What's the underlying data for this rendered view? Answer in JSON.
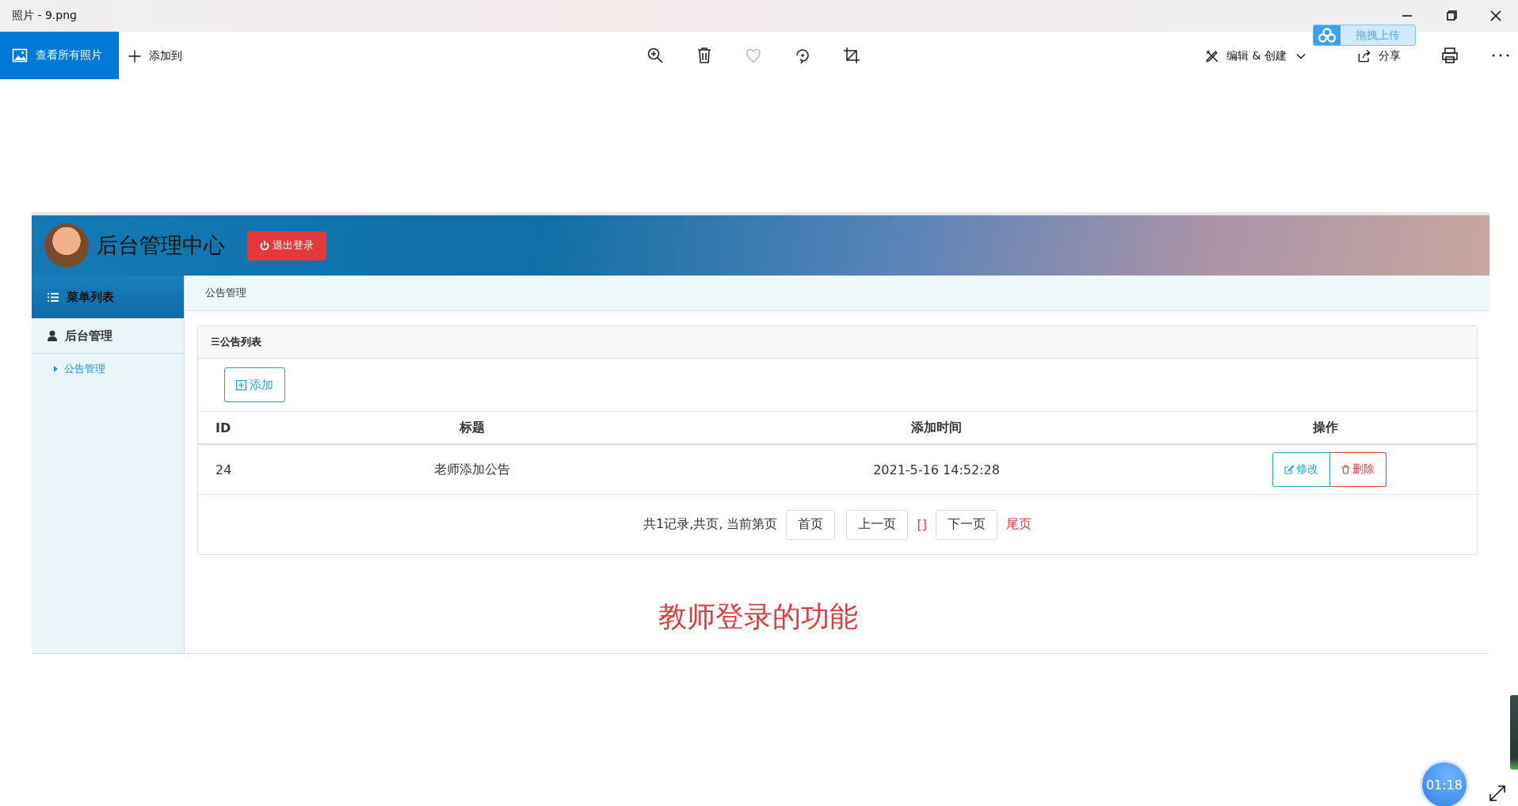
{
  "window": {
    "title": "照片 - 9.png"
  },
  "toolbar": {
    "view_all": "查看所有照片",
    "add_to": "添加到",
    "edit_create": "编辑 & 创建",
    "share": "分享"
  },
  "upload_widget": {
    "label": "拖拽上传"
  },
  "admin": {
    "title": "后台管理中心",
    "logout": "退出登录",
    "sidebar": {
      "header": "菜单列表",
      "groups": [
        {
          "label": "后台管理",
          "children": [
            {
              "label": "公告管理"
            }
          ]
        }
      ]
    },
    "breadcrumb": "公告管理",
    "panel": {
      "title": "☰公告列表",
      "add_button": "添加",
      "columns": [
        "ID",
        "标题",
        "添加时间",
        "操作"
      ],
      "rows": [
        {
          "id": "24",
          "title": "老师添加公告",
          "time": "2021-5-16 14:52:28",
          "actions": [
            {
              "kind": "edit",
              "label": "修改"
            },
            {
              "kind": "delete",
              "label": "删除"
            }
          ]
        }
      ],
      "pagination": {
        "summary": "共1记录,共页, 当前第页",
        "items": [
          {
            "kind": "button",
            "label": "首页"
          },
          {
            "kind": "button",
            "label": "上一页"
          },
          {
            "kind": "current",
            "label": "[]"
          },
          {
            "kind": "button",
            "label": "下一页"
          },
          {
            "kind": "link",
            "label": "尾页"
          }
        ]
      }
    },
    "caption": "教师登录的功能"
  },
  "timer": "01:18"
}
